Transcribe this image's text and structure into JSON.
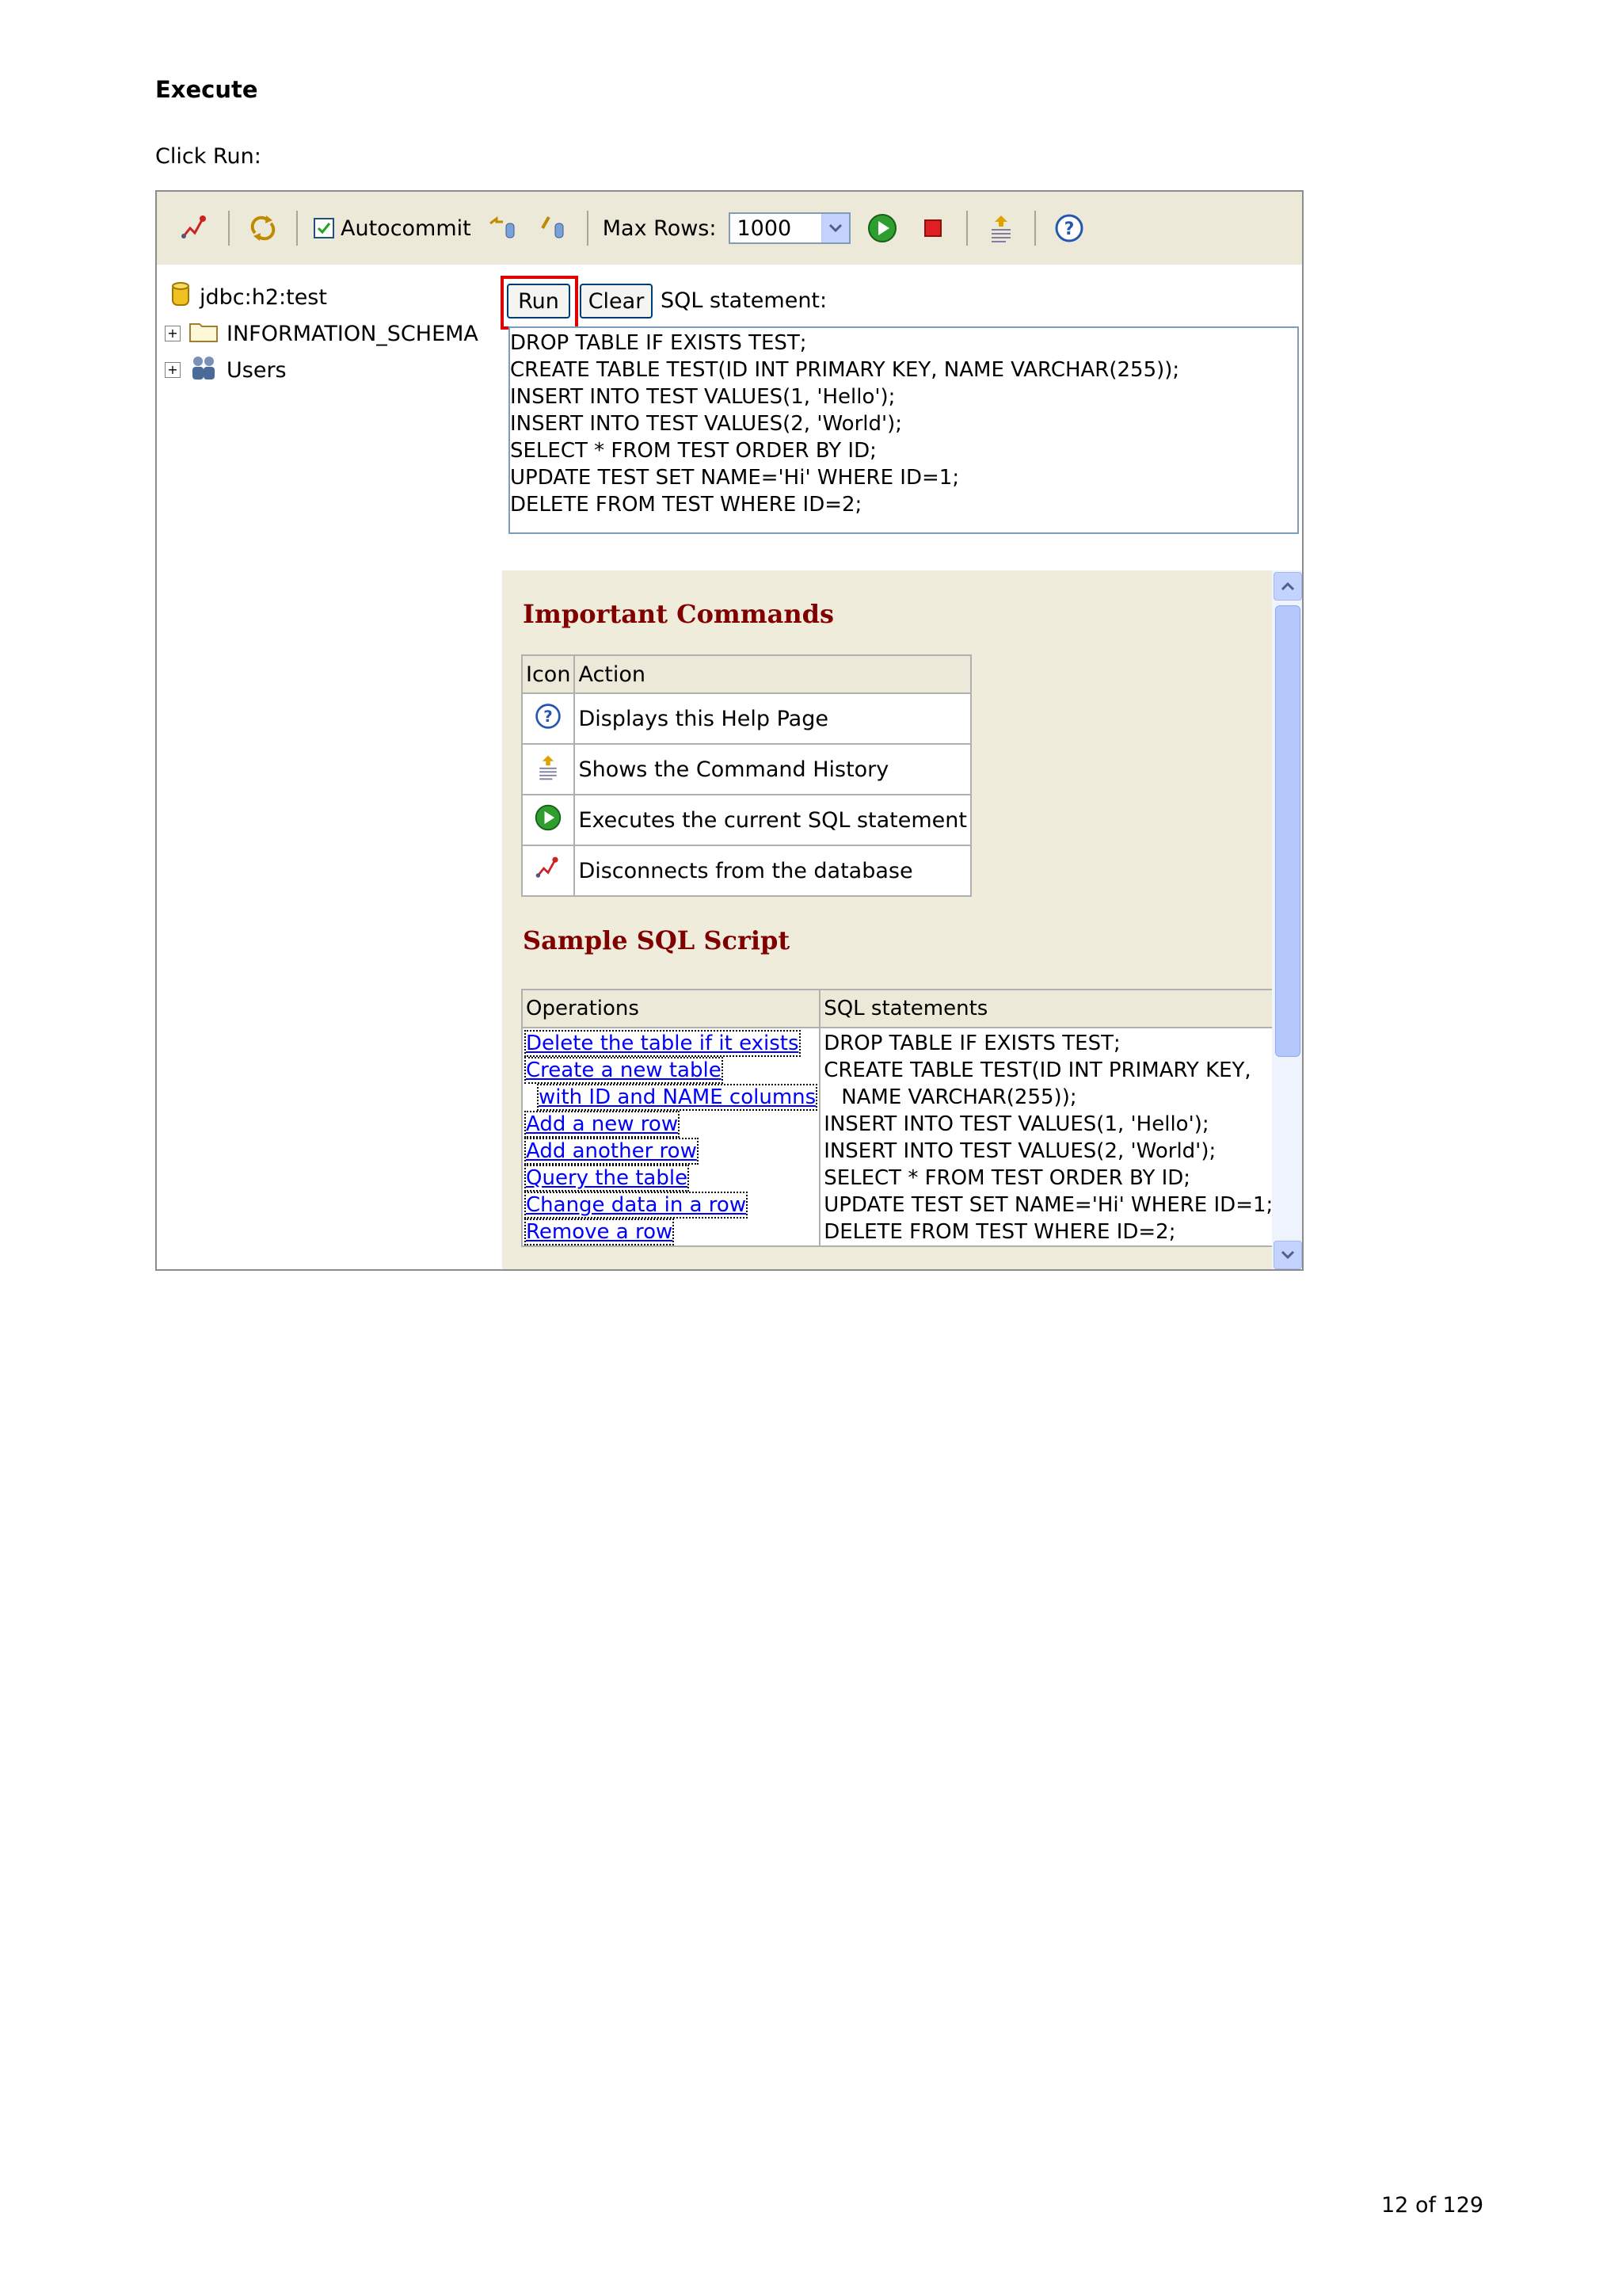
{
  "document": {
    "heading": "Execute",
    "instruction": "Click Run:",
    "page_number": "12 of 129"
  },
  "toolbar": {
    "autocommit_label": "Autocommit",
    "autocommit_checked": true,
    "max_rows_label": "Max Rows:",
    "max_rows_value": "1000"
  },
  "tree": {
    "connection": "jdbc:h2:test",
    "items": [
      {
        "label": "INFORMATION_SCHEMA",
        "expander": "+"
      },
      {
        "label": "Users",
        "expander": "+"
      }
    ]
  },
  "sql_panel": {
    "run_label": "Run",
    "clear_label": "Clear",
    "statement_label": "SQL statement:",
    "lines": [
      "DROP TABLE IF EXISTS TEST;",
      "CREATE TABLE TEST(ID INT PRIMARY KEY, NAME VARCHAR(255));",
      "INSERT INTO TEST VALUES(1, 'Hello');",
      "INSERT INTO TEST VALUES(2, 'World');",
      "SELECT * FROM TEST ORDER BY ID;",
      "UPDATE TEST SET NAME='Hi' WHERE ID=1;",
      "DELETE FROM TEST WHERE ID=2;"
    ]
  },
  "help": {
    "important_title": "Important Commands",
    "cmd_headers": [
      "Icon",
      "Action"
    ],
    "commands": [
      {
        "icon": "help-icon",
        "action": "Displays this Help Page"
      },
      {
        "icon": "history-icon",
        "action": "Shows the Command History"
      },
      {
        "icon": "execute-icon",
        "action": "Executes the current SQL statement"
      },
      {
        "icon": "disconnect-icon",
        "action": "Disconnects from the database"
      }
    ],
    "sample_title": "Sample SQL Script",
    "sample_headers": [
      "Operations",
      "SQL statements"
    ],
    "operations": [
      "Delete the table if it exists",
      "Create a new table",
      "with ID and NAME columns",
      "Add a new row",
      "Add another row",
      "Query the table",
      "Change data in a row",
      "Remove a row"
    ],
    "statements": [
      "DROP TABLE IF EXISTS TEST;",
      "CREATE TABLE TEST(ID INT PRIMARY KEY,",
      "NAME VARCHAR(255));",
      "INSERT INTO TEST VALUES(1, 'Hello');",
      "INSERT INTO TEST VALUES(2, 'World');",
      "SELECT * FROM TEST ORDER BY ID;",
      "UPDATE TEST SET NAME='Hi' WHERE ID=1;",
      "DELETE FROM TEST WHERE ID=2;"
    ]
  },
  "colors": {
    "toolbar_bg": "#ece9d8",
    "help_bg": "#f0ecdc",
    "heading_red": "#800000",
    "link_blue": "#0000ff",
    "highlight_red": "#e00000"
  }
}
